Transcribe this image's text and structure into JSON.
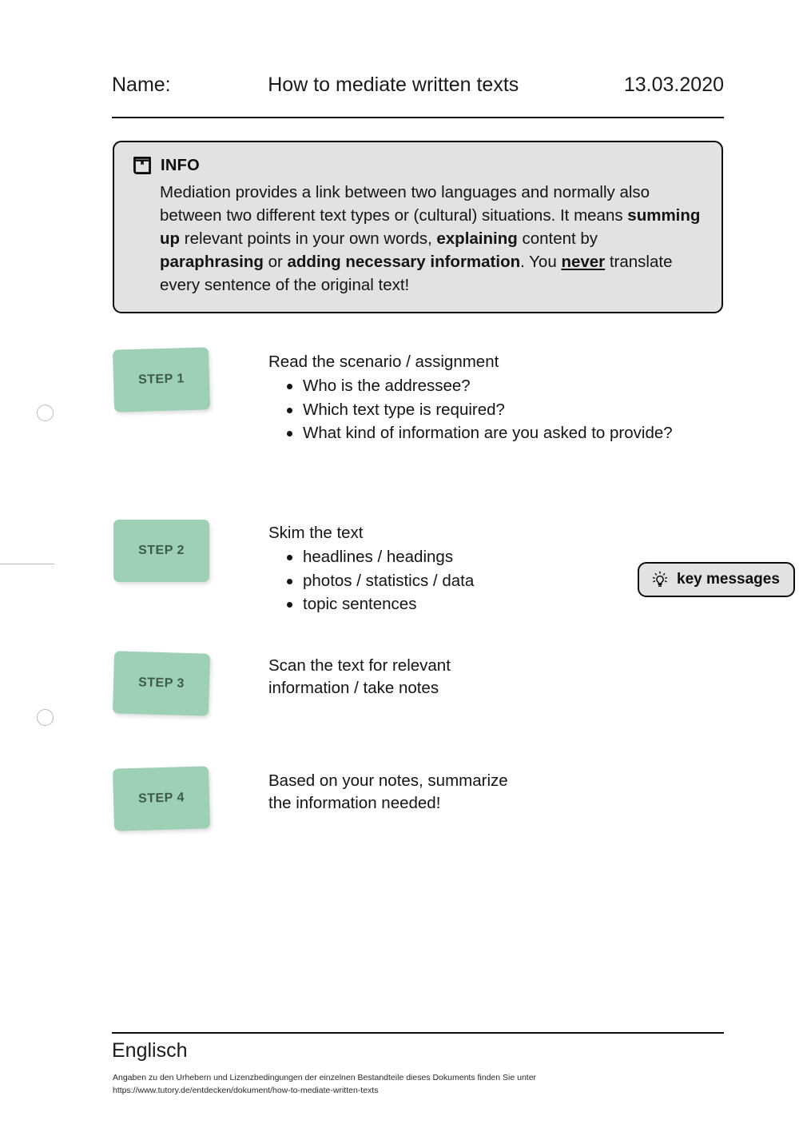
{
  "header": {
    "name_label": "Name:",
    "title": "How to mediate written texts",
    "date": "13.03.2020"
  },
  "info": {
    "icon": "book-bookmark-icon",
    "label": "INFO",
    "text_parts": [
      {
        "text": "Mediation provides a link between two languages and normally also between two different text types or (cultural) situations. It means ",
        "style": "normal"
      },
      {
        "text": "summing up",
        "style": "bold"
      },
      {
        "text": " relevant points in your own words, ",
        "style": "normal"
      },
      {
        "text": "explaining",
        "style": "bold"
      },
      {
        "text": " content by ",
        "style": "normal"
      },
      {
        "text": "paraphrasing",
        "style": "bold"
      },
      {
        "text": " or ",
        "style": "normal"
      },
      {
        "text": "adding necessary information",
        "style": "bold"
      },
      {
        "text": ". You ",
        "style": "normal"
      },
      {
        "text": "never",
        "style": "bold-underline"
      },
      {
        "text": " translate every sentence of the original text!",
        "style": "normal"
      }
    ]
  },
  "steps": [
    {
      "chip_label": "STEP 1",
      "heading": "Read the scenario / assignment",
      "bullets": [
        "Who is the addressee?",
        "Which text type is required?",
        "What kind of information are you asked to provide?"
      ]
    },
    {
      "chip_label": "STEP 2",
      "heading": "Skim the text",
      "bullets": [
        "headlines / headings",
        "photos / statistics / data",
        "topic sentences"
      ]
    },
    {
      "chip_label": "STEP 3",
      "heading": "Scan the text for relevant information / take notes",
      "bullets": []
    },
    {
      "chip_label": "STEP 4",
      "heading": "Based on your notes, summarize the information needed!",
      "bullets": []
    }
  ],
  "key_badge": {
    "icon": "lightbulb-icon",
    "label": "key messages"
  },
  "footer": {
    "subject": "Englisch",
    "legal_line1": "Angaben zu den Urhebern und Lizenzbedingungen der einzelnen Bestandteile dieses Dokuments finden Sie unter",
    "legal_line2": "https://www.tutory.de/entdecken/dokument/how-to-mediate-written-texts"
  },
  "colors": {
    "step_chip_bg": "#9dd0b4",
    "step_chip_text": "#3c5b4b",
    "info_bg": "#e2e2e2",
    "info_border": "#0d0d0d",
    "rule": "#101010",
    "punch_hole": "#b9bdbb"
  }
}
